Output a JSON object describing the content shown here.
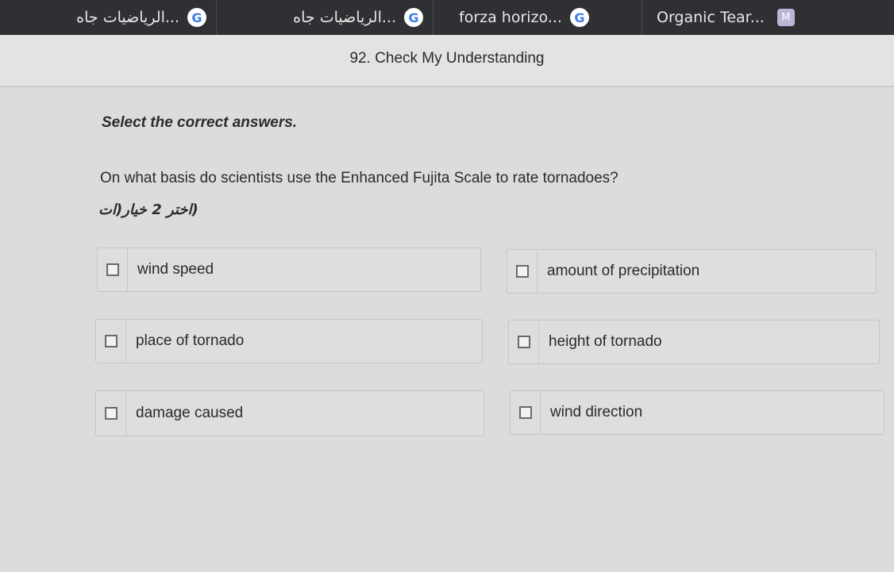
{
  "browser": {
    "tabs": [
      {
        "title": "...الرياضيات جاه",
        "icon": "google-icon"
      },
      {
        "title": "...الرياضيات جاه",
        "icon": "google-icon"
      },
      {
        "title": "forza horizo...",
        "icon": "google-icon"
      },
      {
        "title": "Organic Tear...",
        "icon": "m-icon"
      }
    ]
  },
  "question": {
    "header": "92. Check My Understanding",
    "instruction": "Select the correct answers.",
    "prompt": "On what basis do scientists use the Enhanced Fujita Scale to rate tornadoes?",
    "hint": "(اختر 2 خيار(ات"
  },
  "options": [
    {
      "label": "wind speed",
      "checked": false
    },
    {
      "label": "amount of precipitation",
      "checked": false
    },
    {
      "label": "place of tornado",
      "checked": false
    },
    {
      "label": "height of tornado",
      "checked": false
    },
    {
      "label": "damage caused",
      "checked": false
    },
    {
      "label": "wind direction",
      "checked": false
    }
  ],
  "colors": {
    "tabbar": "#2f3033",
    "page": "#dcdcda",
    "option_border": "#c5c5c3"
  }
}
